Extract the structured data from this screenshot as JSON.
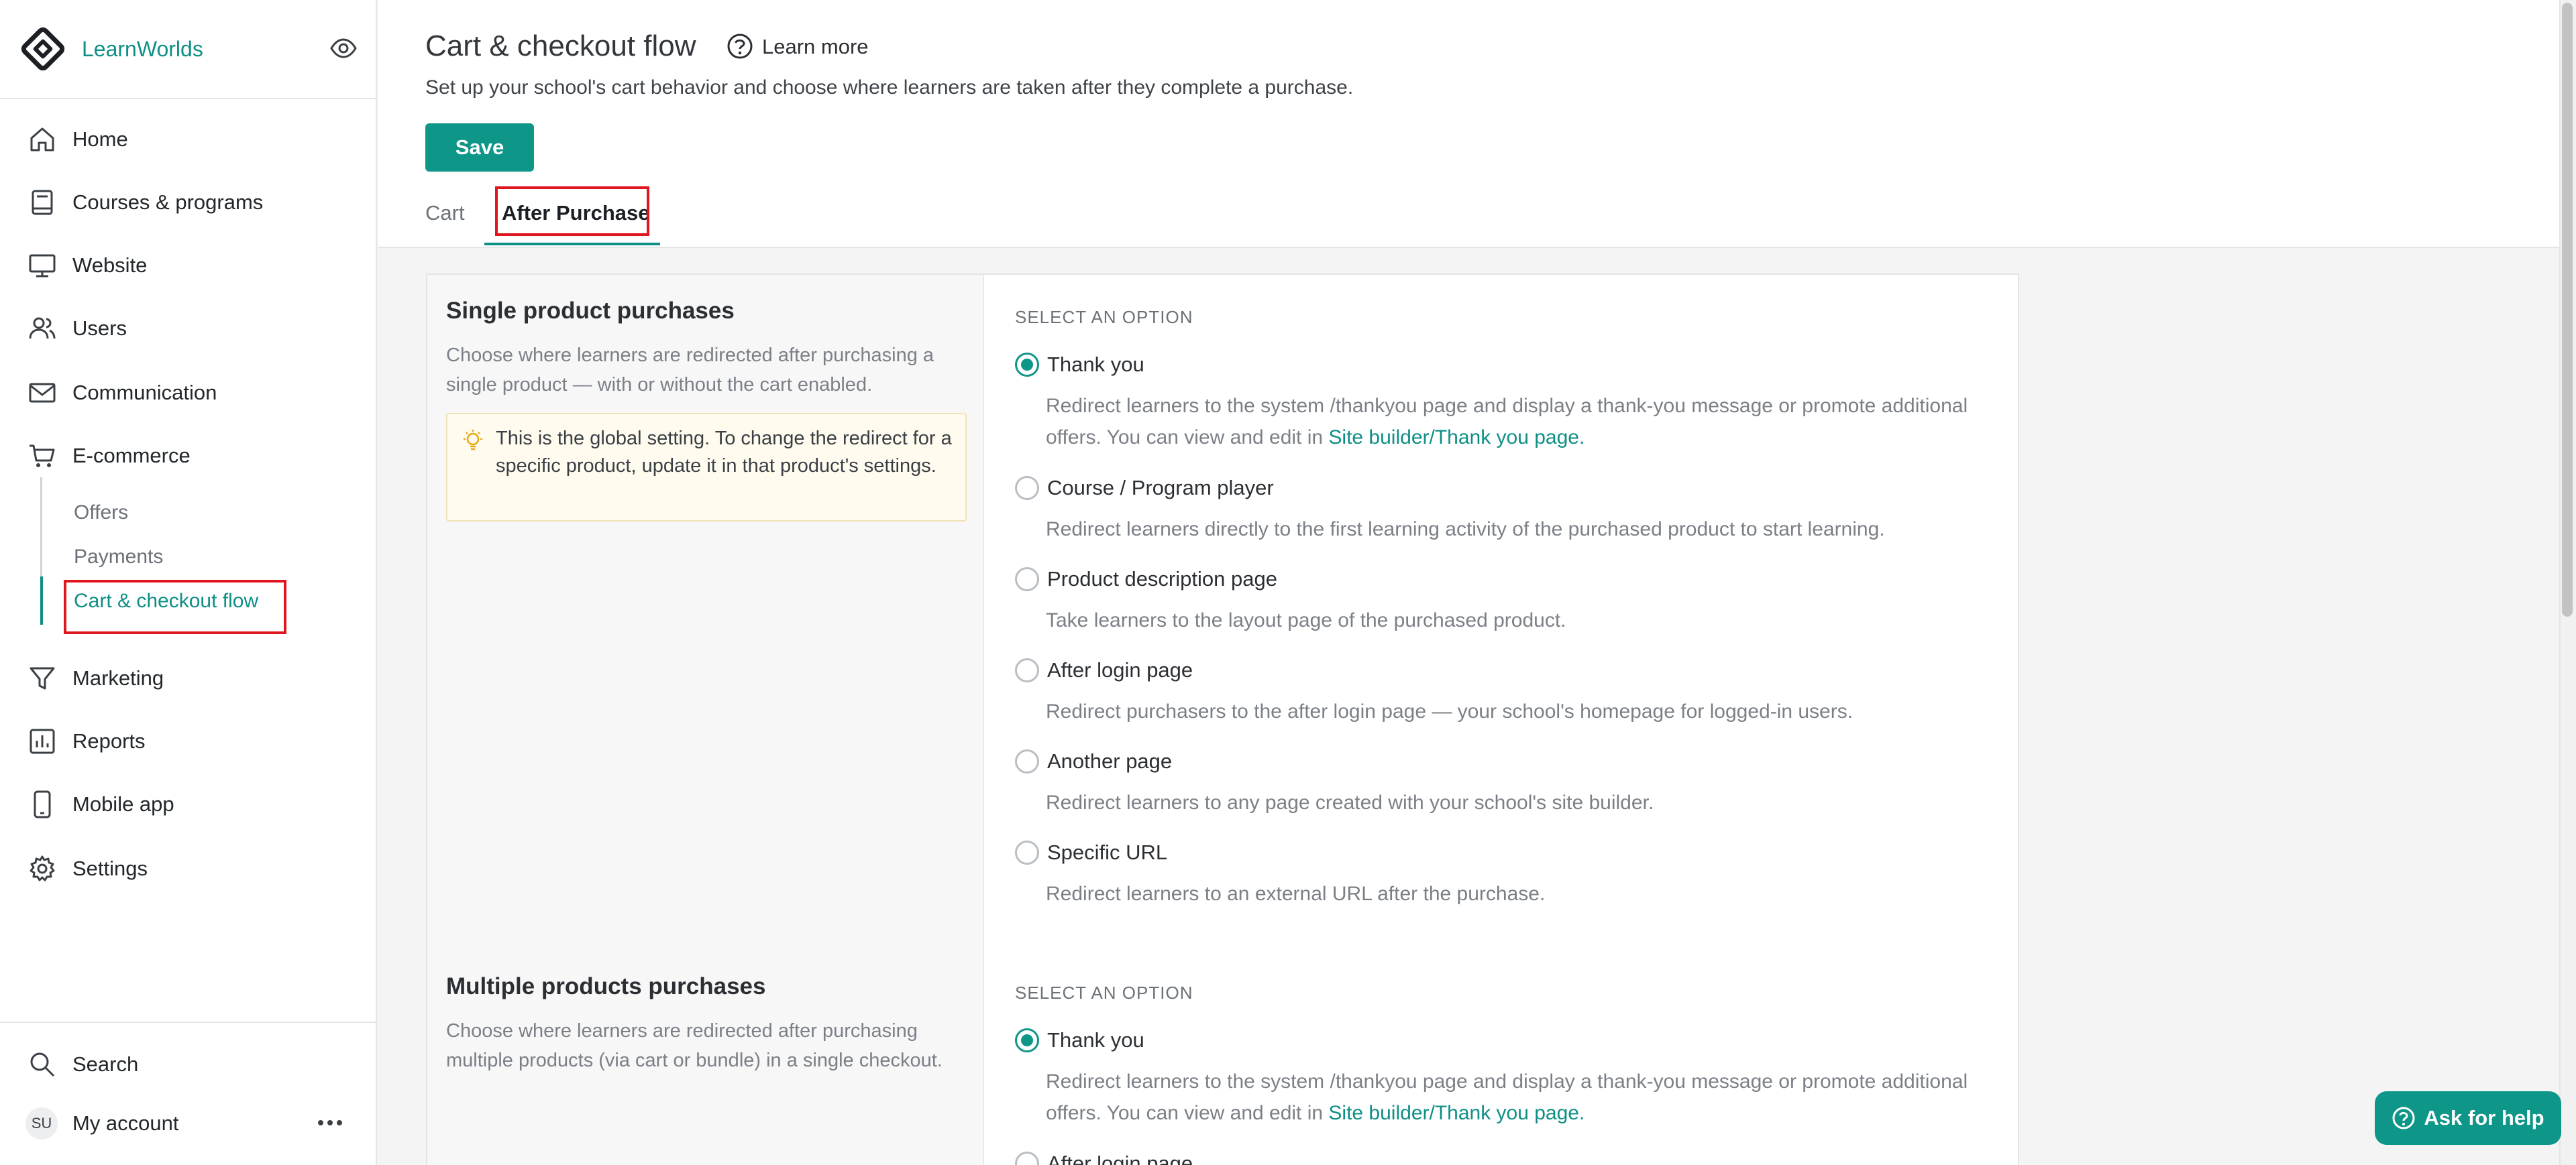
{
  "brand": {
    "name": "LearnWorlds"
  },
  "sidebar": {
    "items": [
      {
        "label": "Home"
      },
      {
        "label": "Courses & programs"
      },
      {
        "label": "Website"
      },
      {
        "label": "Users"
      },
      {
        "label": "Communication"
      },
      {
        "label": "E-commerce"
      },
      {
        "label": "Marketing"
      },
      {
        "label": "Reports"
      },
      {
        "label": "Mobile app"
      },
      {
        "label": "Settings"
      }
    ],
    "ecommerce_sub": [
      {
        "label": "Offers"
      },
      {
        "label": "Payments"
      },
      {
        "label": "Cart & checkout flow"
      }
    ],
    "search_label": "Search",
    "account_label": "My account",
    "avatar_initials": "SU"
  },
  "header": {
    "title": "Cart & checkout flow",
    "learn_more": "Learn more",
    "subtitle": "Set up your school's cart behavior and choose where learners are taken after they complete a purchase.",
    "save_label": "Save",
    "tabs": [
      {
        "label": "Cart"
      },
      {
        "label": "After Purchase"
      }
    ]
  },
  "single": {
    "title": "Single product purchases",
    "desc": "Choose where learners are redirected after purchasing a single product — with or without the cart enabled.",
    "tip": "This is the global setting. To change the redirect for a specific product, update it in that product's settings.",
    "select_label": "SELECT AN OPTION",
    "options": [
      {
        "label": "Thank you",
        "desc": "Redirect learners to the system /thankyou page and display a thank-you message or promote additional offers. You can view and edit in ",
        "link": "Site builder/Thank you page."
      },
      {
        "label": "Course / Program player",
        "desc": "Redirect learners directly to the first learning activity of the purchased product to start learning."
      },
      {
        "label": "Product description page",
        "desc": "Take learners to the layout page of the purchased product."
      },
      {
        "label": "After login page",
        "desc": "Redirect purchasers to the after login page — your school's homepage for logged-in users."
      },
      {
        "label": "Another page",
        "desc": "Redirect learners to any page created with your school's site builder."
      },
      {
        "label": "Specific URL",
        "desc": "Redirect learners to an external URL after the purchase."
      }
    ]
  },
  "multiple": {
    "title": "Multiple products purchases",
    "desc": "Choose where learners are redirected after purchasing multiple products (via cart or bundle) in a single checkout.",
    "select_label": "SELECT AN OPTION",
    "options": [
      {
        "label": "Thank you",
        "desc": "Redirect learners to the system /thankyou page and display a thank-you message or promote additional offers. You can view and edit in ",
        "link": "Site builder/Thank you page."
      },
      {
        "label": "After login page"
      }
    ]
  },
  "help": {
    "label": "Ask for help"
  },
  "colors": {
    "accent": "#0e9688",
    "highlight": "#e0161e"
  }
}
